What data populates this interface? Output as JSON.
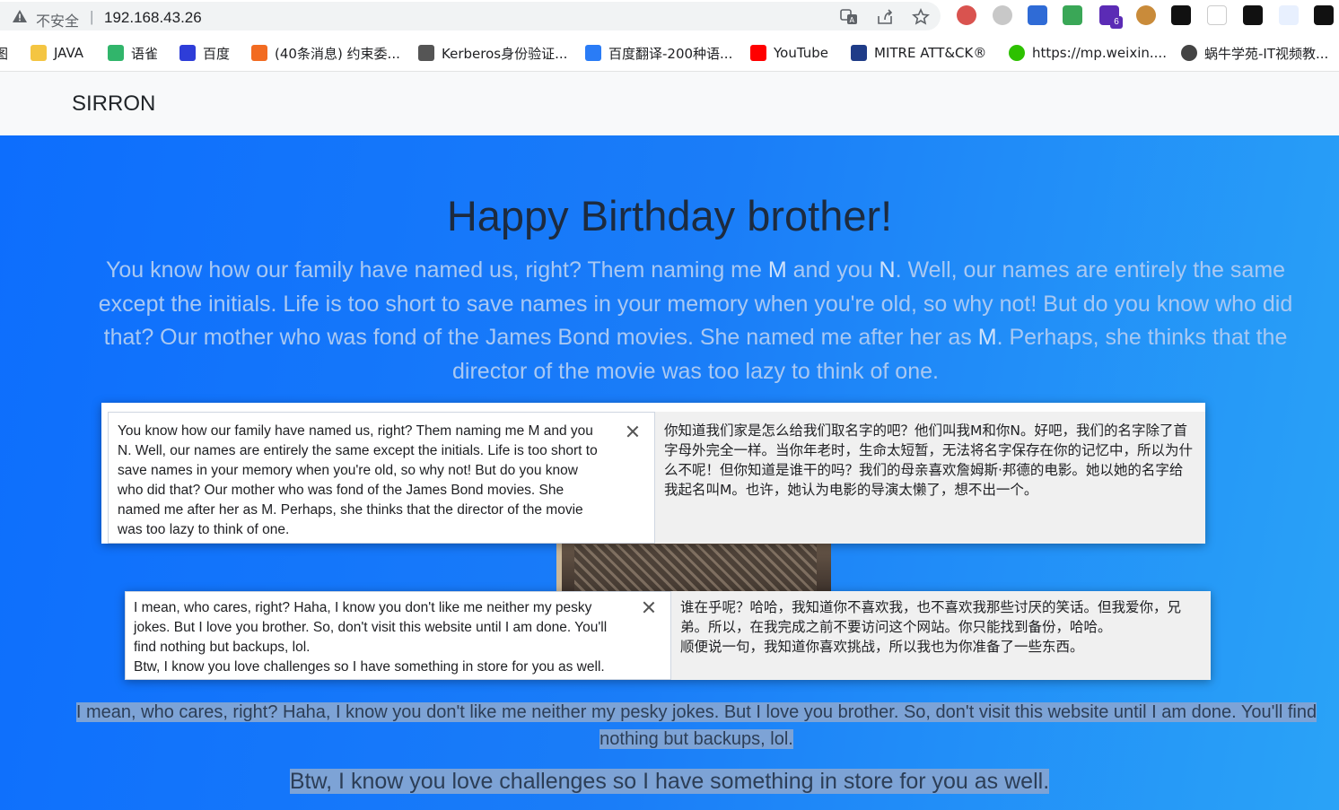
{
  "browser": {
    "security_label": "不安全",
    "url": "192.168.43.26",
    "bookmarks": [
      {
        "label": "图",
        "color": "#777777"
      },
      {
        "label": "JAVA",
        "color": "#f4c542"
      },
      {
        "label": "语雀",
        "color": "#31b56b"
      },
      {
        "label": "百度",
        "color": "#2e3dd8"
      },
      {
        "label": "(40条消息) 约束委...",
        "color": "#f26b21"
      },
      {
        "label": "Kerberos身份验证...",
        "color": "#555555"
      },
      {
        "label": "百度翻译-200种语...",
        "color": "#2a7cf6"
      },
      {
        "label": "YouTube",
        "color": "#ff0000"
      },
      {
        "label": "MITRE ATT&CK®",
        "color": "#1f3c88"
      },
      {
        "label": "https://mp.weixin....",
        "color": "#2dc100"
      },
      {
        "label": "蜗牛学苑-IT视频教...",
        "color": "#444444"
      }
    ],
    "ext_badge": "6"
  },
  "navbar": {
    "brand": "SIRRON"
  },
  "hero": {
    "title": "Happy Birthday brother!",
    "lead_1": "You know how our family have named us, right? Them naming me ",
    "lead_m1": "M",
    "lead_2": " and you ",
    "lead_n": "N",
    "lead_3": ". Well, our names are entirely the same except the initials. Life is too short to save names in your memory when you're old, so why not! But do you know who did that? Our mother who was fond of the James Bond movies. She named me after her as ",
    "lead_m2": "M",
    "lead_4": ". Perhaps, she thinks that the director of the movie was too lazy to think of one.",
    "para2": "I mean, who cares, right? Haha, I know you don't like me neither my pesky jokes. But I love you brother. So, don't visit this website until I am done. You'll find nothing but backups, lol.",
    "para3": "Btw, I know you love challenges so I have something in store for you as well."
  },
  "translate_popup_1": {
    "source": "You know how our family have named us, right? Them naming me M and you N. Well, our names are entirely the same except the initials. Life is too short to save names in your memory when you're old, so why not! But do you know who did that? Our mother who was fond of the James Bond movies. She named me after her as M. Perhaps, she thinks that the director of the movie was too lazy to think of one.",
    "target": "你知道我们家是怎么给我们取名字的吧？他们叫我M和你N。好吧，我们的名字除了首字母外完全一样。当你年老时，生命太短暂，无法将名字保存在你的记忆中，所以为什么不呢！但你知道是谁干的吗？我们的母亲喜欢詹姆斯·邦德的电影。她以她的名字给我起名叫M。也许，她认为电影的导演太懒了，想不出一个。"
  },
  "translate_popup_2": {
    "source_line1": "I mean, who cares, right? Haha, I know you don't like me neither my pesky jokes. But I love you brother. So, don't visit this website until I am done. You'll find nothing but backups, lol.",
    "source_line2": "Btw, I know you love challenges so I have something in store for you as well.",
    "target_line1": "谁在乎呢？哈哈，我知道你不喜欢我，也不喜欢我那些讨厌的笑话。但我爱你，兄弟。所以，在我完成之前不要访问这个网站。你只能找到备份，哈哈。",
    "target_line2": "顺便说一句，我知道你喜欢挑战，所以我也为你准备了一些东西。"
  },
  "colors": {
    "hero_start": "#0d6efd",
    "hero_end": "#2aa3f7",
    "navbar_bg": "#f8f9fa",
    "selection": "#7da3d6"
  }
}
